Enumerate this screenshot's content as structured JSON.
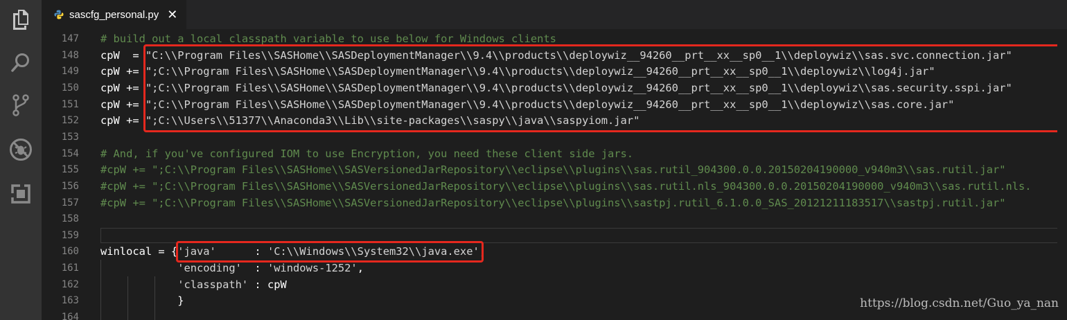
{
  "tab": {
    "filename": "sascfg_personal.py",
    "close_glyph": "✕"
  },
  "activity_icons": [
    "files-icon",
    "search-icon",
    "source-control-icon",
    "debug-icon",
    "extensions-icon"
  ],
  "colors": {
    "comment": "#608b4e",
    "string": "#ce9178",
    "plain": "#ffffff",
    "highlight": "#e5281e"
  },
  "lines": [
    {
      "num": "147",
      "parts": [
        {
          "t": "# build out a local classpath variable to use below for Windows clients",
          "c": "comment"
        }
      ]
    },
    {
      "num": "148",
      "parts": [
        {
          "t": "cpW  = ",
          "c": "plain"
        },
        {
          "t": "\"C:\\\\Program Files\\\\SASHome\\\\SASDeploymentManager\\\\9.4\\\\products\\\\deploywiz__94260__prt__xx__sp0__1\\\\deploywiz\\\\sas.svc.connection.jar\"",
          "c": "string"
        }
      ]
    },
    {
      "num": "149",
      "parts": [
        {
          "t": "cpW += ",
          "c": "plain"
        },
        {
          "t": "\";C:\\\\Program Files\\\\SASHome\\\\SASDeploymentManager\\\\9.4\\\\products\\\\deploywiz__94260__prt__xx__sp0__1\\\\deploywiz\\\\log4j.jar\"",
          "c": "string"
        }
      ]
    },
    {
      "num": "150",
      "parts": [
        {
          "t": "cpW += ",
          "c": "plain"
        },
        {
          "t": "\";C:\\\\Program Files\\\\SASHome\\\\SASDeploymentManager\\\\9.4\\\\products\\\\deploywiz__94260__prt__xx__sp0__1\\\\deploywiz\\\\sas.security.sspi.jar\"",
          "c": "string"
        }
      ]
    },
    {
      "num": "151",
      "parts": [
        {
          "t": "cpW += ",
          "c": "plain"
        },
        {
          "t": "\";C:\\\\Program Files\\\\SASHome\\\\SASDeploymentManager\\\\9.4\\\\products\\\\deploywiz__94260__prt__xx__sp0__1\\\\deploywiz\\\\sas.core.jar\"",
          "c": "string"
        }
      ]
    },
    {
      "num": "152",
      "parts": [
        {
          "t": "cpW += ",
          "c": "plain"
        },
        {
          "t": "\";C:\\\\Users\\\\51377\\\\Anaconda3\\\\Lib\\\\site-packages\\\\saspy\\\\java\\\\saspyiom.jar\"",
          "c": "string"
        }
      ]
    },
    {
      "num": "153",
      "parts": []
    },
    {
      "num": "154",
      "parts": [
        {
          "t": "# And, if you've configured IOM to use Encryption, you need these client side jars.",
          "c": "comment"
        }
      ]
    },
    {
      "num": "155",
      "parts": [
        {
          "t": "#cpW += \";C:\\\\Program Files\\\\SASHome\\\\SASVersionedJarRepository\\\\eclipse\\\\plugins\\\\sas.rutil_904300.0.0.20150204190000_v940m3\\\\sas.rutil.jar\"",
          "c": "comment"
        }
      ]
    },
    {
      "num": "156",
      "parts": [
        {
          "t": "#cpW += \";C:\\\\Program Files\\\\SASHome\\\\SASVersionedJarRepository\\\\eclipse\\\\plugins\\\\sas.rutil.nls_904300.0.0.20150204190000_v940m3\\\\sas.rutil.nls.",
          "c": "comment"
        }
      ]
    },
    {
      "num": "157",
      "parts": [
        {
          "t": "#cpW += \";C:\\\\Program Files\\\\SASHome\\\\SASVersionedJarRepository\\\\eclipse\\\\plugins\\\\sastpj.rutil_6.1.0.0_SAS_20121211183517\\\\sastpj.rutil.jar\"",
          "c": "comment"
        }
      ]
    },
    {
      "num": "158",
      "parts": []
    },
    {
      "num": "159",
      "parts": []
    },
    {
      "num": "160",
      "parts": [
        {
          "t": "winlocal = {",
          "c": "plain"
        },
        {
          "t": "'java'",
          "c": "string"
        },
        {
          "t": "      : ",
          "c": "plain"
        },
        {
          "t": "'C:\\\\Windows\\\\System32\\\\java.exe'",
          "c": "string"
        },
        {
          "t": ",",
          "c": "plain"
        }
      ]
    },
    {
      "num": "161",
      "parts": [
        {
          "t": "            ",
          "c": "plain"
        },
        {
          "t": "'encoding'",
          "c": "string"
        },
        {
          "t": "  : ",
          "c": "plain"
        },
        {
          "t": "'windows-1252'",
          "c": "string"
        },
        {
          "t": ",",
          "c": "plain"
        }
      ]
    },
    {
      "num": "162",
      "parts": [
        {
          "t": "            ",
          "c": "plain"
        },
        {
          "t": "'classpath'",
          "c": "string"
        },
        {
          "t": " : cpW",
          "c": "plain"
        }
      ]
    },
    {
      "num": "163",
      "parts": [
        {
          "t": "            }",
          "c": "plain"
        }
      ]
    },
    {
      "num": "164",
      "parts": []
    }
  ],
  "watermark": "https://blog.csdn.net/Guo_ya_nan"
}
